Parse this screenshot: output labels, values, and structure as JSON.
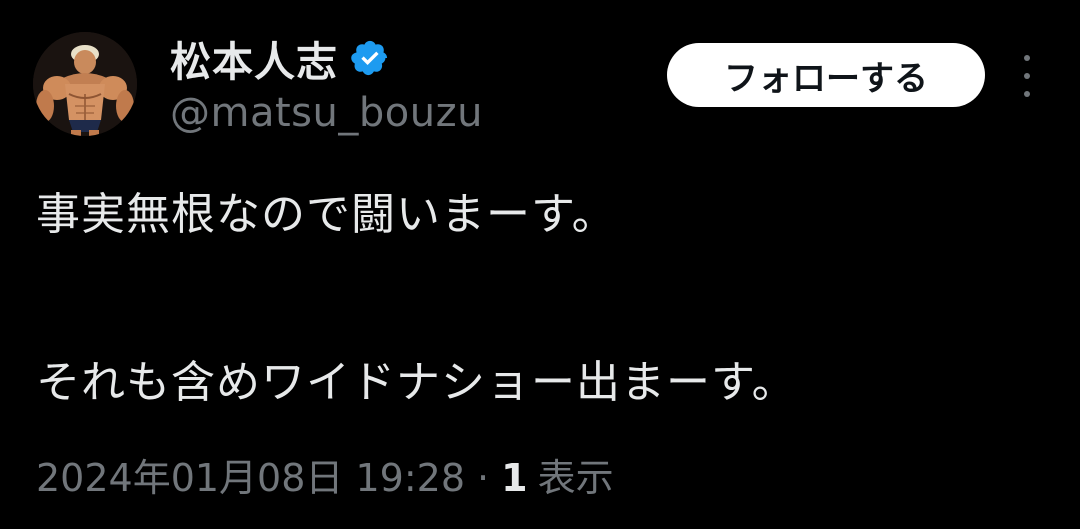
{
  "tweet": {
    "author": {
      "display_name": "松本人志",
      "handle": "@matsu_bouzu",
      "verified": true,
      "avatar_icon": "avatar-image"
    },
    "follow_label": "フォローする",
    "more_icon": "more-options-icon",
    "text_lines": [
      "事実無根なので闘いまーす。",
      "それも含めワイドナショー出まーす。"
    ],
    "timestamp": "2024年01月08日 19:28",
    "separator": "·",
    "views_count": "1",
    "views_label": "表示"
  },
  "colors": {
    "background": "#000000",
    "primary_text": "#e7e9ea",
    "secondary_text": "#71767b",
    "verified_blue": "#1d9bf0",
    "follow_button_bg": "#ffffff"
  }
}
